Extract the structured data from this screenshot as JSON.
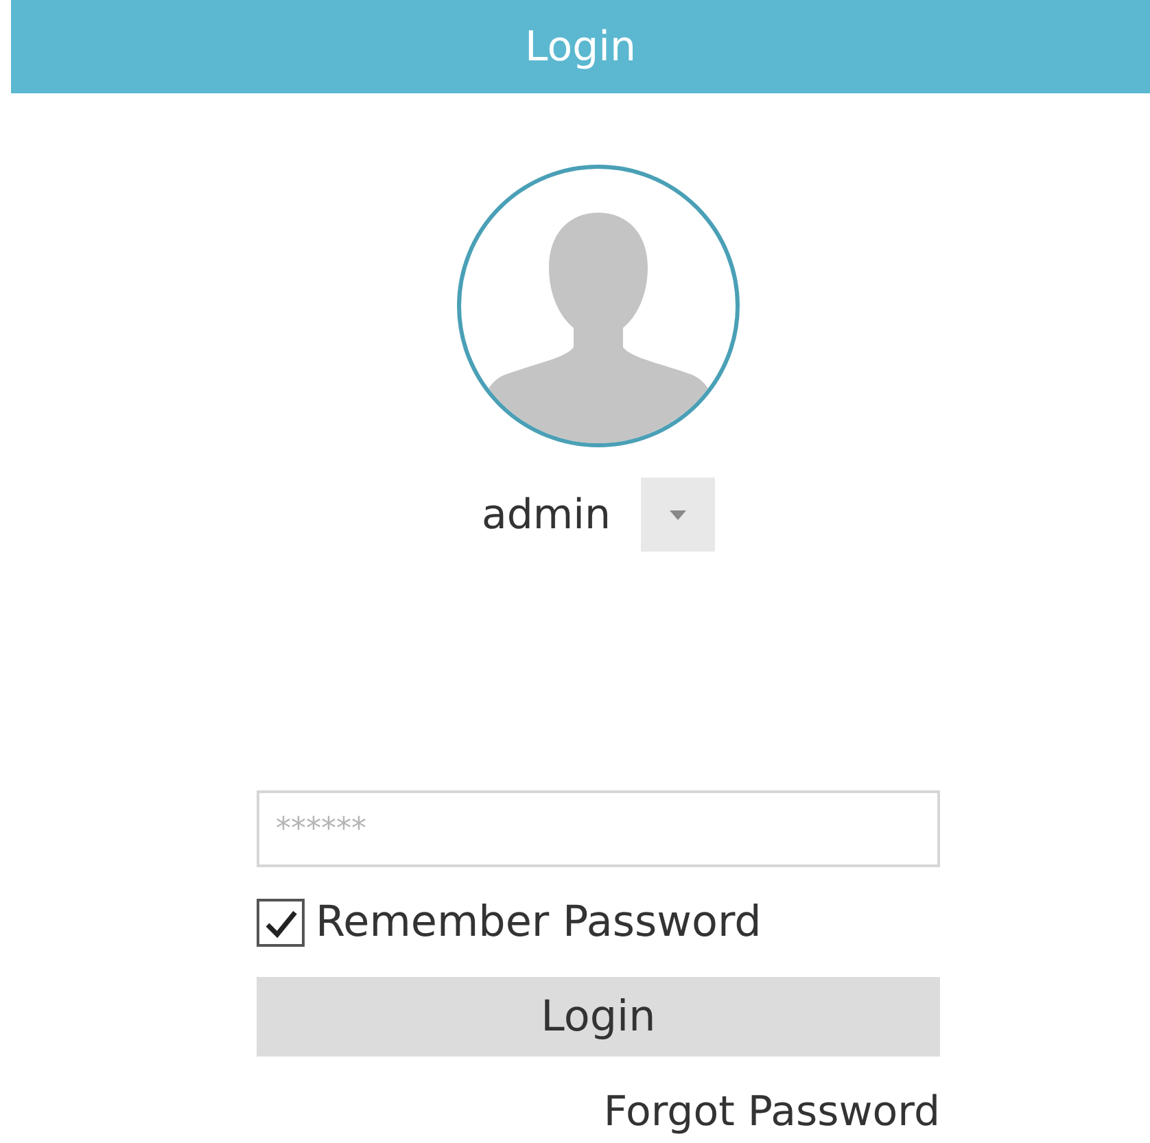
{
  "header": {
    "title": "Login"
  },
  "user": {
    "name": "admin"
  },
  "password": {
    "placeholder": "******"
  },
  "remember": {
    "label": "Remember Password",
    "checked": true
  },
  "login_button": {
    "label": "Login"
  },
  "forgot_link": {
    "label": "Forgot Password"
  }
}
